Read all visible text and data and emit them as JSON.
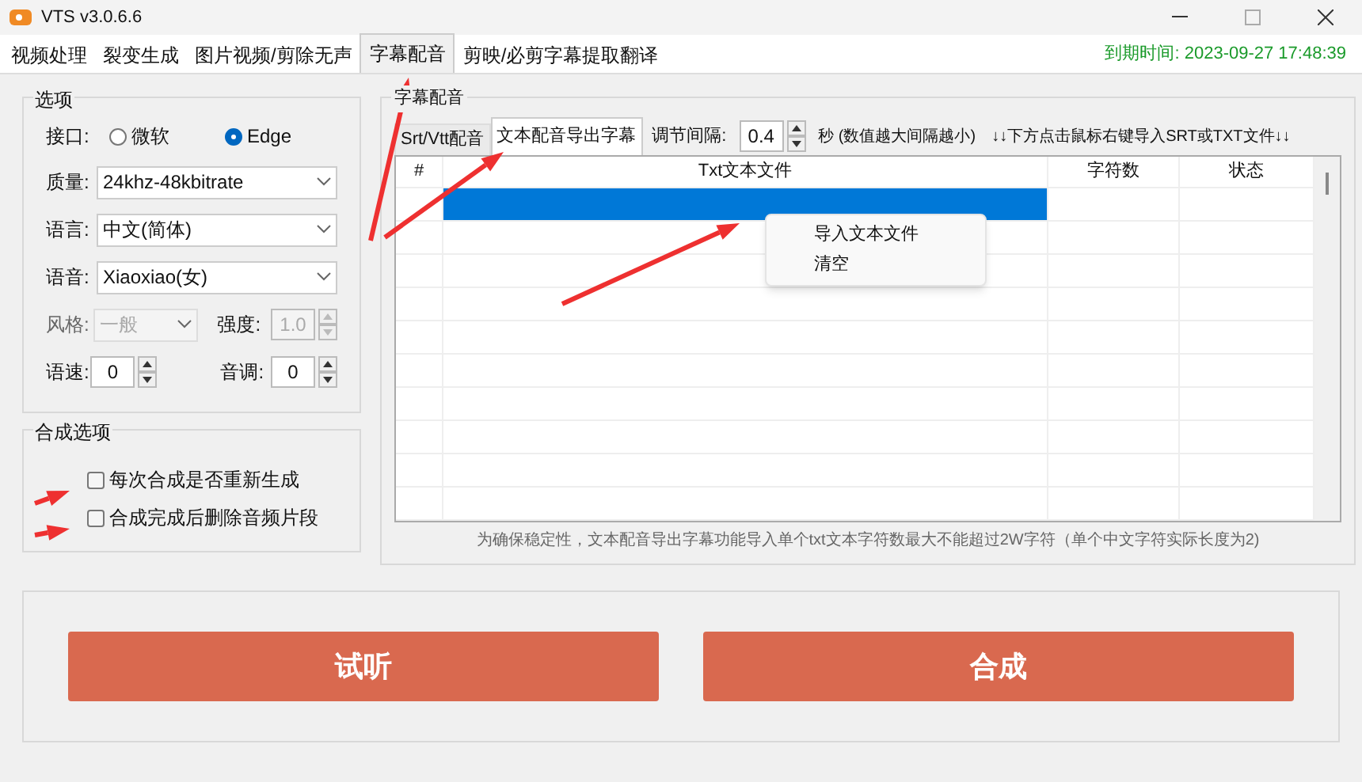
{
  "window": {
    "title": "VTS v3.0.6.6"
  },
  "tabs": [
    {
      "label": "视频处理",
      "selected": false
    },
    {
      "label": "裂变生成",
      "selected": false
    },
    {
      "label": "图片视频/剪除无声",
      "selected": false
    },
    {
      "label": "字幕配音",
      "selected": true
    },
    {
      "label": "剪映/必剪字幕提取翻译",
      "selected": false
    }
  ],
  "expiry": "到期时间: 2023-09-27 17:48:39",
  "options": {
    "title": "选项",
    "interface": {
      "label": "接口:",
      "choices": [
        {
          "label": "微软",
          "selected": false
        },
        {
          "label": "Edge",
          "selected": true
        }
      ]
    },
    "selects": [
      {
        "label": "质量:",
        "value": "24khz-48kbitrate",
        "disabled": false
      },
      {
        "label": "语言:",
        "value": "中文(简体)",
        "disabled": false
      },
      {
        "label": "语音:",
        "value": "Xiaoxiao(女)",
        "disabled": false
      }
    ],
    "style": {
      "label": "风格:",
      "value": "一般",
      "disabled": true
    },
    "intensity": {
      "label": "强度:",
      "value": "1.0",
      "disabled": true
    },
    "speed": {
      "label": "语速:",
      "value": "0",
      "disabled": false
    },
    "pitch": {
      "label": "音调:",
      "value": "0",
      "disabled": false
    }
  },
  "synth_options": {
    "title": "合成选项",
    "checkboxes": [
      {
        "label": "每次合成是否重新生成",
        "checked": false
      },
      {
        "label": "合成完成后删除音频片段",
        "checked": false
      }
    ]
  },
  "subtitle_panel": {
    "title": "字幕配音",
    "subtabs": [
      {
        "label": "Srt/Vtt配音",
        "selected": false
      },
      {
        "label": "文本配音导出字幕",
        "selected": true
      }
    ],
    "interval_label": "调节间隔:",
    "interval_value": "0.4",
    "interval_hint": "秒 (数值越大间隔越小)",
    "instruction": "↓↓下方点击鼠标右键导入SRT或TXT文件↓↓",
    "table": {
      "columns": [
        "#",
        "Txt文本文件",
        "字符数",
        "状态"
      ],
      "rows": [
        {
          "selected": true
        },
        {
          "selected": false
        },
        {
          "selected": false
        },
        {
          "selected": false
        },
        {
          "selected": false
        },
        {
          "selected": false
        },
        {
          "selected": false
        },
        {
          "selected": false
        },
        {
          "selected": false
        },
        {
          "selected": false
        }
      ]
    },
    "context_menu": [
      "导入文本文件",
      "清空"
    ],
    "note": "为确保稳定性，文本配音导出字幕功能导入单个txt文本字符数最大不能超过2W字符（单个中文字符实际长度为2)"
  },
  "buttons": [
    {
      "label": "试听"
    },
    {
      "label": "合成"
    }
  ]
}
